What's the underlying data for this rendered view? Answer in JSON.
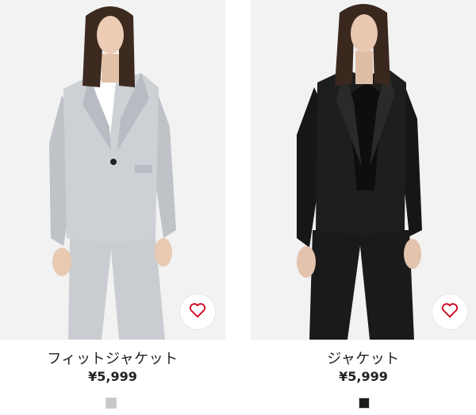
{
  "products": [
    {
      "name": "フィットジャケット",
      "price": "¥5,999",
      "swatch_color": "#c8c8c8",
      "icon": "heart-icon"
    },
    {
      "name": "ジャケット",
      "price": "¥5,999",
      "swatch_color": "#1c1c1c",
      "icon": "heart-icon"
    }
  ],
  "colors": {
    "heart": "#d0021b",
    "background": "#ffffff"
  }
}
